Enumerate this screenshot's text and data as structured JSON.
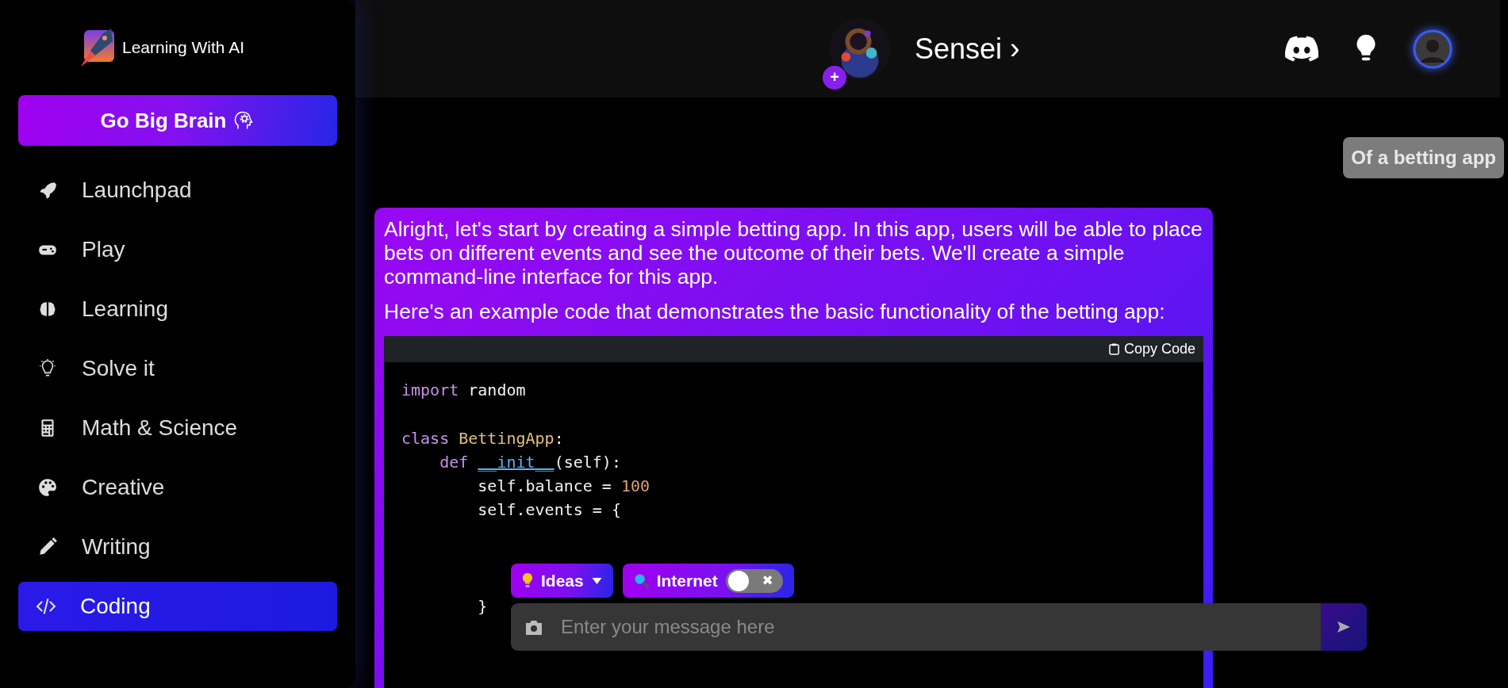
{
  "brand": {
    "name": "Learning With AI"
  },
  "upgrade_button": {
    "label": "Go Big Brain"
  },
  "sidebar": {
    "items": [
      {
        "label": "Launchpad",
        "selected": false
      },
      {
        "label": "Play",
        "selected": false
      },
      {
        "label": "Learning",
        "selected": false
      },
      {
        "label": "Solve it",
        "selected": false
      },
      {
        "label": "Math & Science",
        "selected": false
      },
      {
        "label": "Creative",
        "selected": false
      },
      {
        "label": "Writing",
        "selected": false
      },
      {
        "label": "Coding",
        "selected": true
      }
    ]
  },
  "header": {
    "add_label": "+",
    "bot_name": "Sensei",
    "chevron": "›"
  },
  "messages": [
    {
      "kind": "user",
      "text": "Of a betting app"
    },
    {
      "kind": "assistant",
      "paragraphs": [
        "Alright, let's start by creating a simple betting app. In this app, users will be able to place bets on different events and see the outcome of their bets. We'll create a simple command-line interface for this app.",
        "Here's an example code that demonstrates the basic functionality of the betting app:"
      ],
      "code": {
        "copy_label": "Copy Code",
        "lines": [
          {
            "kind": "code",
            "tokens": [
              {
                "kind": "keyword",
                "text": "import"
              },
              {
                "kind": "plain",
                "text": " random"
              }
            ]
          },
          {
            "kind": "blank"
          },
          {
            "kind": "code",
            "tokens": [
              {
                "kind": "keyword",
                "text": "class "
              },
              {
                "kind": "class",
                "text": "BettingApp"
              },
              {
                "kind": "plain",
                "text": ":"
              }
            ]
          },
          {
            "kind": "code",
            "tokens": [
              {
                "kind": "keyword",
                "text": "    def "
              },
              {
                "kind": "func",
                "text": "__init__"
              },
              {
                "kind": "plain",
                "text": "(self):"
              }
            ]
          },
          {
            "kind": "code",
            "tokens": [
              {
                "kind": "plain",
                "text": "        self.balance = "
              },
              {
                "kind": "number",
                "text": "100"
              }
            ]
          },
          {
            "kind": "code",
            "tokens": [
              {
                "kind": "plain",
                "text": "        self.events = {"
              }
            ]
          },
          {
            "kind": "blank"
          },
          {
            "kind": "blank"
          },
          {
            "kind": "blank"
          },
          {
            "kind": "code",
            "tokens": [
              {
                "kind": "plain",
                "text": "        }"
              }
            ]
          }
        ]
      }
    }
  ],
  "composer": {
    "ideas_label": "Ideas",
    "internet_label": "Internet",
    "internet_on": false,
    "toggle_mark": "✖",
    "placeholder": "Enter your message here"
  }
}
